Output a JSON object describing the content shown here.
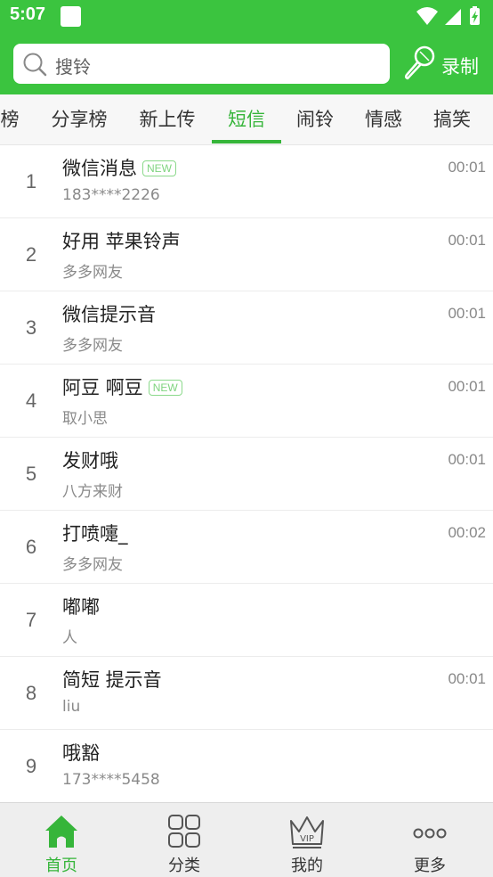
{
  "status_bar": {
    "time": "5:07"
  },
  "search": {
    "placeholder": "搜铃"
  },
  "header": {
    "record_label": "录制"
  },
  "tabs": [
    "榜",
    "分享榜",
    "新上传",
    "短信",
    "闹铃",
    "情感",
    "搞笑"
  ],
  "active_tab": "短信",
  "new_badge": "NEW",
  "songs": [
    {
      "index": "1",
      "title": "微信消息",
      "is_new": true,
      "subtitle": "183****2226",
      "duration": "00:01"
    },
    {
      "index": "2",
      "title": "好用 苹果铃声",
      "is_new": false,
      "subtitle": "多多网友",
      "duration": "00:01"
    },
    {
      "index": "3",
      "title": "微信提示音",
      "is_new": false,
      "subtitle": "多多网友",
      "duration": "00:01"
    },
    {
      "index": "4",
      "title": "阿豆 啊豆",
      "is_new": true,
      "subtitle": "取小思",
      "duration": "00:01"
    },
    {
      "index": "5",
      "title": "发财哦",
      "is_new": false,
      "subtitle": "八方来财",
      "duration": "00:01"
    },
    {
      "index": "6",
      "title": "打喷嚏_",
      "is_new": false,
      "subtitle": "多多网友",
      "duration": "00:02"
    },
    {
      "index": "7",
      "title": "嘟嘟",
      "is_new": false,
      "subtitle": "人",
      "duration": ""
    },
    {
      "index": "8",
      "title": "简短 提示音",
      "is_new": false,
      "subtitle": "liu",
      "duration": "00:01"
    },
    {
      "index": "9",
      "title": "哦豁",
      "is_new": false,
      "subtitle": "173****5458",
      "duration": ""
    }
  ],
  "bottom_nav": [
    {
      "label": "首页",
      "icon": "home-icon",
      "active": true
    },
    {
      "label": "分类",
      "icon": "category-grid-icon",
      "active": false
    },
    {
      "label": "我的",
      "icon": "vip-crown-icon",
      "active": false
    },
    {
      "label": "更多",
      "icon": "more-dots-icon",
      "active": false
    }
  ],
  "colors": {
    "brand_green": "#3bc43f",
    "active_green": "#36b53a",
    "new_badge": "#7fd47f"
  }
}
